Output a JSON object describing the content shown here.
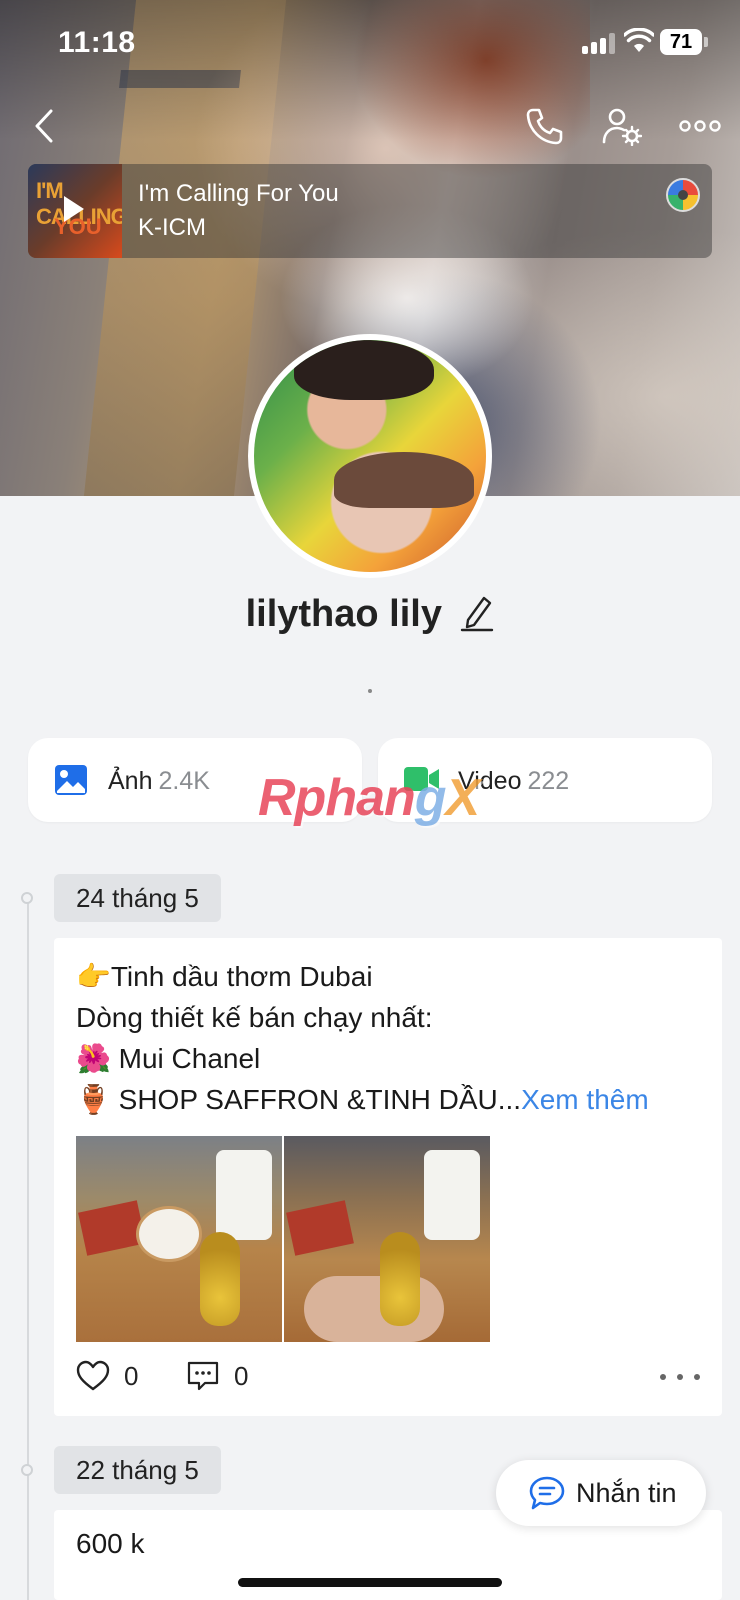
{
  "status_bar": {
    "time": "11:18",
    "battery": "71"
  },
  "music": {
    "song": "I'm Calling For You",
    "artist": "K-ICM",
    "thumb_text_1": "I'M CALLING",
    "thumb_text_2": "YOU"
  },
  "profile": {
    "name": "lilythao lily",
    "bio": "."
  },
  "media": {
    "photos": {
      "label": "Ảnh",
      "count": "2.4K"
    },
    "videos": {
      "label": "Video",
      "count": "222"
    }
  },
  "watermark": {
    "part1": "Rphan",
    "part2": "g",
    "part3": "X"
  },
  "timeline": [
    {
      "date": "24 tháng 5",
      "lines": [
        "👉Tinh dầu thơm Dubai",
        "Dòng thiết kế bán chạy nhất:",
        "🌺 Mui Chanel",
        "🏺 SHOP SAFFRON &TINH DẦU..."
      ],
      "more_label": "Xem thêm",
      "likes": "0",
      "comments": "0"
    },
    {
      "date": "22 tháng 5",
      "text": "600 k"
    }
  ],
  "message_button": {
    "label": "Nhắn tin"
  },
  "icons": {
    "back": "chevron-left-icon",
    "call": "phone-icon",
    "user_settings": "user-gear-icon",
    "more": "more-horizontal-icon",
    "photos": "image-icon",
    "videos": "video-camera-icon",
    "edit": "pencil-icon",
    "like": "heart-icon",
    "comment": "comment-icon",
    "message": "chat-bubble-icon"
  },
  "colors": {
    "accent": "#3b86e6",
    "photo_icon": "#1f6ee8",
    "video_icon": "#2fbf6a",
    "background": "#f2f3f5"
  }
}
